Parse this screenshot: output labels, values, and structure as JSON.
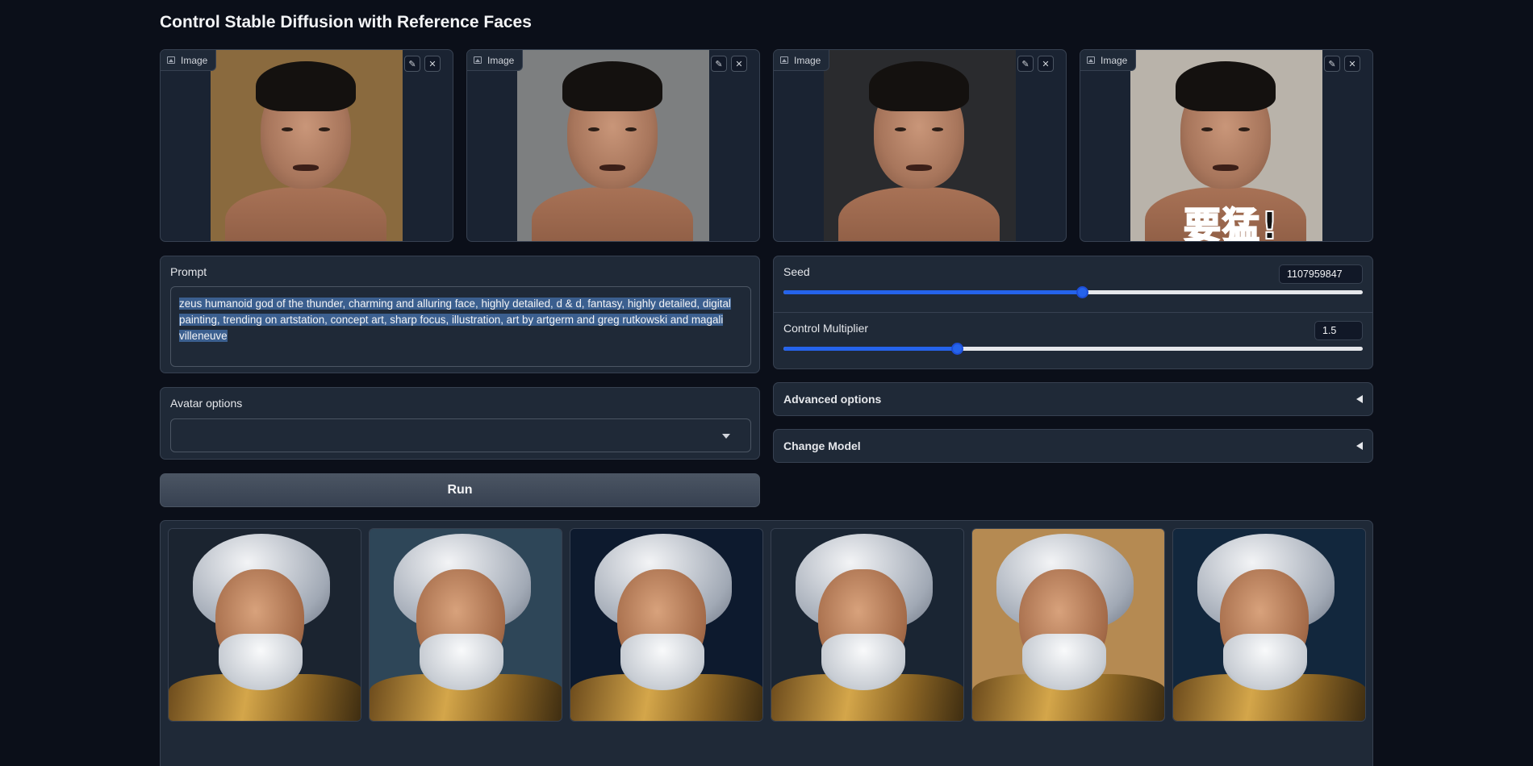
{
  "page": {
    "title": "Control Stable Diffusion with Reference Faces"
  },
  "reference_images": [
    {
      "label": "Image",
      "edit_icon": "pencil-icon",
      "clear_icon": "close-icon",
      "background": "#8a6a3e",
      "overlay_text": ""
    },
    {
      "label": "Image",
      "edit_icon": "pencil-icon",
      "clear_icon": "close-icon",
      "background": "#7d7f80",
      "overlay_text": ""
    },
    {
      "label": "Image",
      "edit_icon": "pencil-icon",
      "clear_icon": "close-icon",
      "background": "#2a2b2e",
      "overlay_text": ""
    },
    {
      "label": "Image",
      "edit_icon": "pencil-icon",
      "clear_icon": "close-icon",
      "background": "#b9b3aa",
      "overlay_text": "要猛!"
    }
  ],
  "prompt": {
    "label": "Prompt",
    "value": "zeus humanoid god of the thunder, charming and alluring face, highly detailed, d & d, fantasy, highly detailed, digital painting, trending on artstation, concept art, sharp focus, illustration, art by artgerm and greg rutkowski and magali villeneuve"
  },
  "avatar_options": {
    "label": "Avatar options",
    "value": ""
  },
  "seed": {
    "label": "Seed",
    "value": "1107959847",
    "fraction": 0.516
  },
  "control_multiplier": {
    "label": "Control Multiplier",
    "value": "1.5",
    "fraction": 0.3
  },
  "advanced_options": {
    "label": "Advanced options"
  },
  "change_model": {
    "label": "Change Model"
  },
  "run_button": {
    "label": "Run"
  },
  "gallery": {
    "images": [
      {
        "name": "generated-image-1",
        "background": "#1b2430"
      },
      {
        "name": "generated-image-2",
        "background": "#2e4658"
      },
      {
        "name": "generated-image-3",
        "background": "#0d1a2e"
      },
      {
        "name": "generated-image-4",
        "background": "#1a2533"
      },
      {
        "name": "generated-image-5",
        "background": "#b58a52"
      },
      {
        "name": "generated-image-6",
        "background": "#12273d"
      }
    ]
  },
  "colors": {
    "background": "#0b0f19",
    "panel": "#1f2937",
    "accent": "#2563eb"
  }
}
